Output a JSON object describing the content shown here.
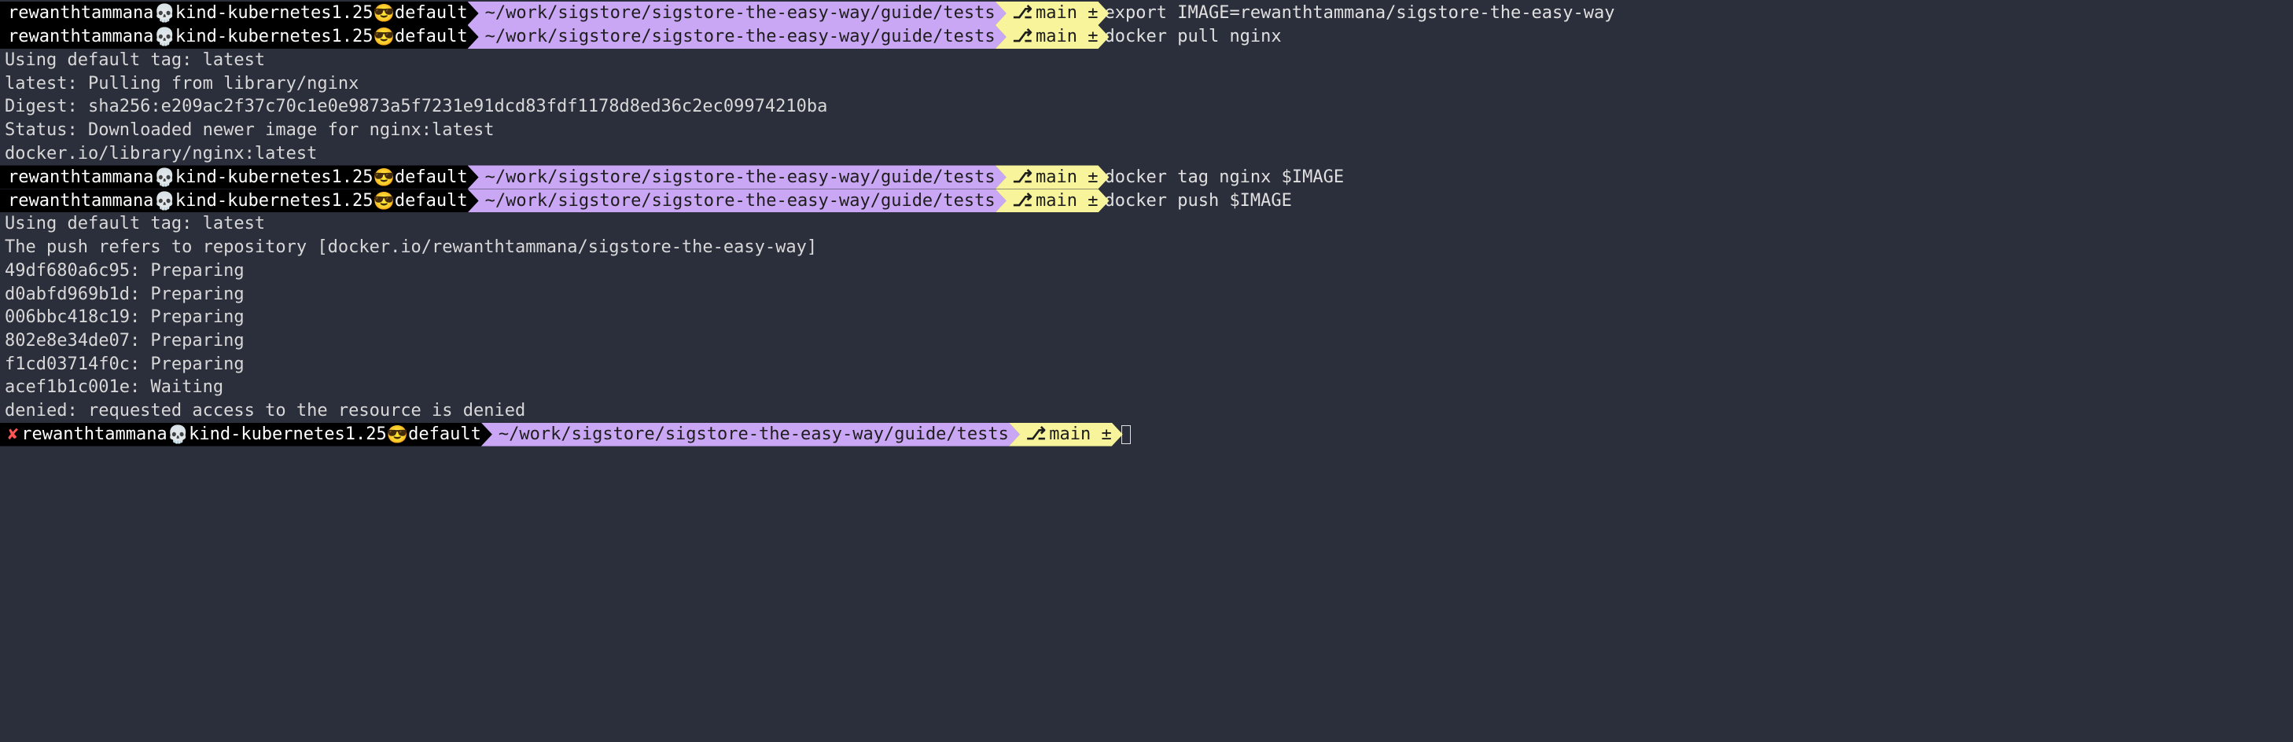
{
  "host": {
    "user": "rewanthtammana",
    "icon1": "💀",
    "cluster": "kind-kubernetes1.25",
    "icon2": "😎",
    "ns": "default"
  },
  "cwd": "~/work/sigstore/sigstore-the-easy-way/guide/tests",
  "branch": {
    "glyph": "⎇",
    "name": "main",
    "dirty": "±"
  },
  "status_fail": "✘",
  "cmd1": "export IMAGE=rewanthtammana/sigstore-the-easy-way",
  "cmd2": "docker pull nginx",
  "out_pull": [
    "Using default tag: latest",
    "latest: Pulling from library/nginx",
    "Digest: sha256:e209ac2f37c70c1e0e9873a5f7231e91dcd83fdf1178d8ed36c2ec09974210ba",
    "Status: Downloaded newer image for nginx:latest",
    "docker.io/library/nginx:latest"
  ],
  "cmd3": "docker tag nginx $IMAGE",
  "cmd4": "docker push $IMAGE",
  "out_push": [
    "Using default tag: latest",
    "The push refers to repository [docker.io/rewanthtammana/sigstore-the-easy-way]",
    "49df680a6c95: Preparing",
    "d0abfd969b1d: Preparing",
    "006bbc418c19: Preparing",
    "802e8e34de07: Preparing",
    "f1cd03714f0c: Preparing",
    "acef1b1c001e: Waiting",
    "denied: requested access to the resource is denied"
  ]
}
